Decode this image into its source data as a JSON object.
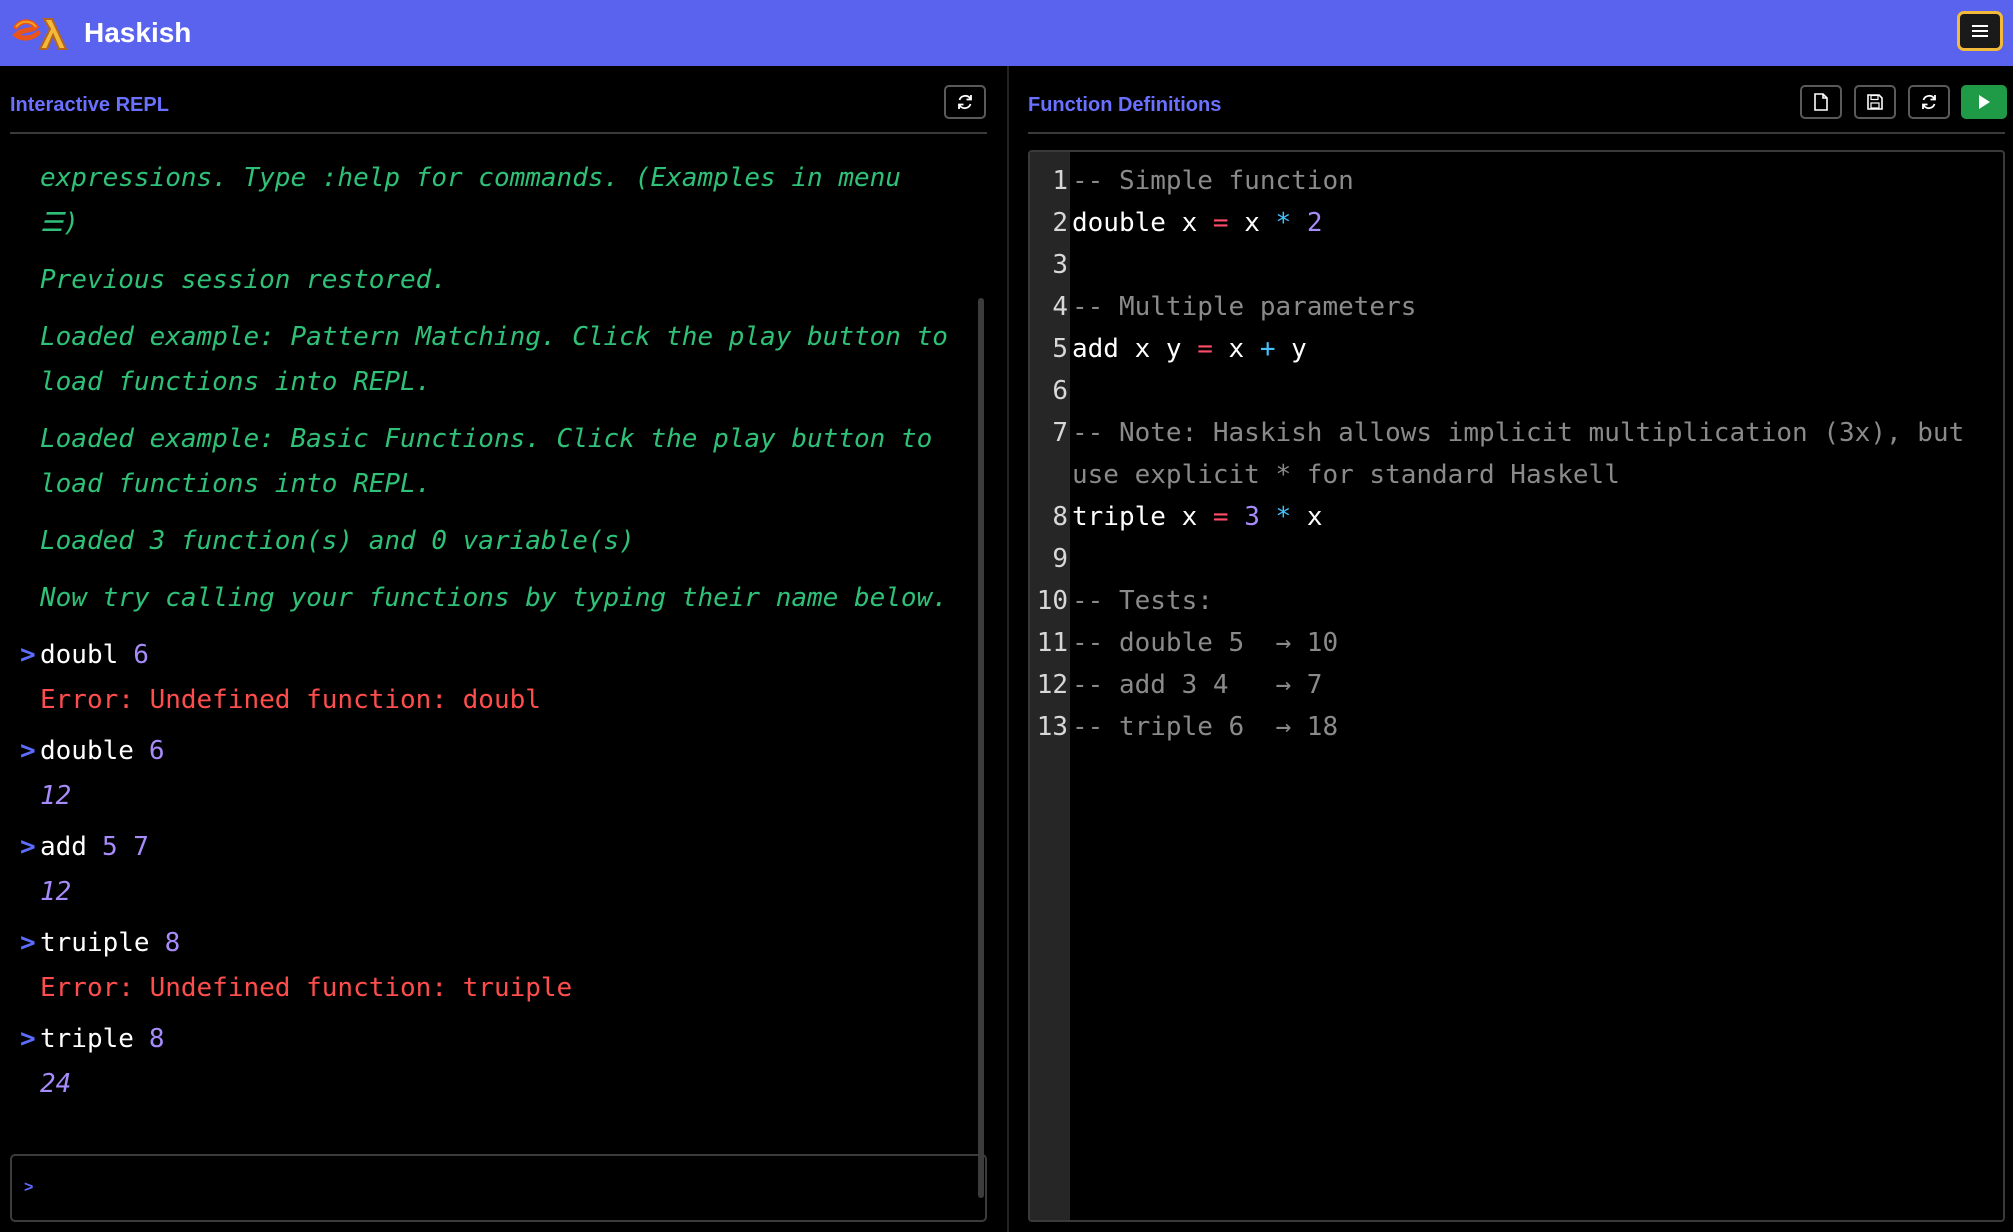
{
  "app": {
    "title": "Haskish",
    "logo_icon": "lambda-logo-icon",
    "menu_icon": "hamburger-menu-icon",
    "accent": "#5a63ee"
  },
  "repl": {
    "title": "Interactive REPL",
    "reset_icon": "refresh-icon",
    "messages": [
      "expressions. Type :help for commands. (Examples in menu ☰)",
      "Previous session restored.",
      "Loaded example: Pattern Matching. Click the play button to load functions into REPL.",
      "Loaded example: Basic Functions. Click the play button to load functions into REPL.",
      "Loaded 3 function(s) and 0 variable(s)",
      "Now try calling your functions by typing their name below."
    ],
    "history": [
      {
        "fn": "doubl",
        "args": "6",
        "output": "Error: Undefined function: doubl",
        "is_error": true
      },
      {
        "fn": "double",
        "args": "6",
        "output": "12",
        "is_error": false
      },
      {
        "fn": "add",
        "args": "5 7",
        "output": "12",
        "is_error": false
      },
      {
        "fn": "truiple",
        "args": "8",
        "output": "Error: Undefined function: truiple",
        "is_error": true
      },
      {
        "fn": "triple",
        "args": "8",
        "output": "24",
        "is_error": false
      }
    ],
    "prompt_symbol": ">",
    "input_value": ""
  },
  "editor": {
    "title": "Function Definitions",
    "buttons": {
      "new_icon": "new-file-icon",
      "save_icon": "save-icon",
      "reset_icon": "refresh-icon",
      "run_icon": "play-icon"
    },
    "lines": [
      {
        "n": "1",
        "tokens": [
          {
            "t": "-- Simple function",
            "c": "com"
          }
        ]
      },
      {
        "n": "2",
        "tokens": [
          {
            "t": "double x ",
            "c": "id"
          },
          {
            "t": "=",
            "c": "eq"
          },
          {
            "t": " x ",
            "c": "id"
          },
          {
            "t": "*",
            "c": "op"
          },
          {
            "t": " 2",
            "c": "num"
          }
        ]
      },
      {
        "n": "3",
        "tokens": []
      },
      {
        "n": "4",
        "tokens": [
          {
            "t": "-- Multiple parameters",
            "c": "com"
          }
        ]
      },
      {
        "n": "5",
        "tokens": [
          {
            "t": "add x y ",
            "c": "id"
          },
          {
            "t": "=",
            "c": "eq"
          },
          {
            "t": " x ",
            "c": "id"
          },
          {
            "t": "+",
            "c": "op"
          },
          {
            "t": " y",
            "c": "id"
          }
        ]
      },
      {
        "n": "6",
        "tokens": []
      },
      {
        "n": "7",
        "tokens": [
          {
            "t": "-- Note: Haskish allows implicit multiplication (3x), but use explicit * for standard Haskell",
            "c": "com"
          }
        ]
      },
      {
        "n": "8",
        "tokens": [
          {
            "t": "triple x ",
            "c": "id"
          },
          {
            "t": "=",
            "c": "eq"
          },
          {
            "t": " 3",
            "c": "num"
          },
          {
            "t": " ",
            "c": "id"
          },
          {
            "t": "*",
            "c": "op"
          },
          {
            "t": " x",
            "c": "id"
          }
        ]
      },
      {
        "n": "9",
        "tokens": []
      },
      {
        "n": "10",
        "tokens": [
          {
            "t": "-- Tests:",
            "c": "com"
          }
        ]
      },
      {
        "n": "11",
        "tokens": [
          {
            "t": "-- double 5  → 10",
            "c": "com"
          }
        ]
      },
      {
        "n": "12",
        "tokens": [
          {
            "t": "-- add 3 4   → 7",
            "c": "com"
          }
        ]
      },
      {
        "n": "13",
        "tokens": [
          {
            "t": "-- triple 6  → 18",
            "c": "com"
          }
        ]
      }
    ]
  }
}
